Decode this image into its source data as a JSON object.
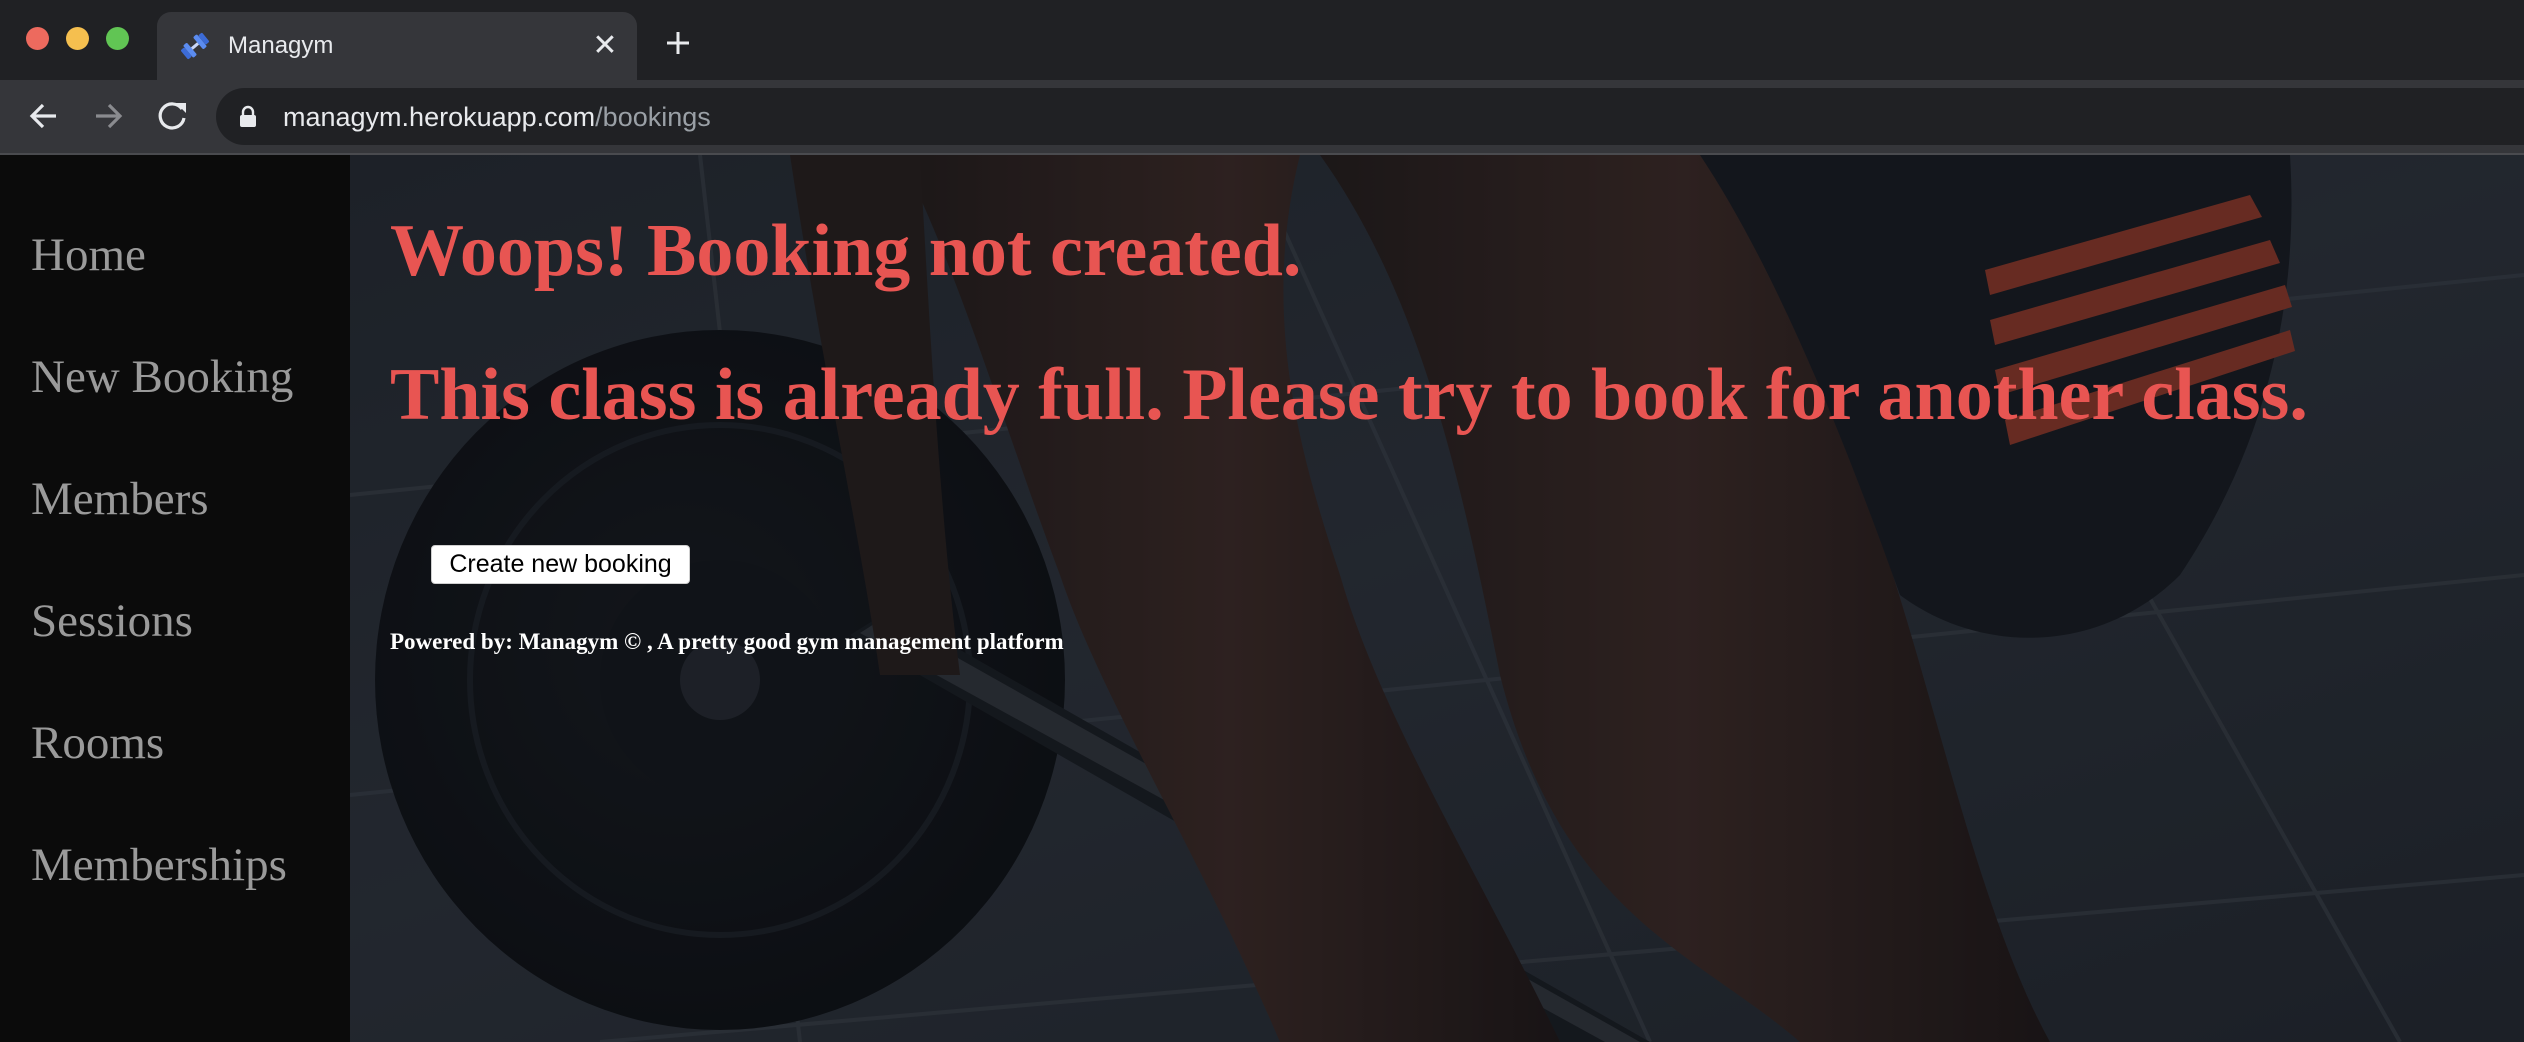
{
  "browser": {
    "tab": {
      "title": "Managym",
      "favicon": "dumbbell-icon",
      "close_label": "✕"
    },
    "new_tab_icon": "plus-icon",
    "omnibox": {
      "host": "managym.herokuapp.com",
      "path": "/bookings"
    }
  },
  "sidebar": {
    "items": [
      {
        "label": "Home"
      },
      {
        "label": "New Booking"
      },
      {
        "label": "Members"
      },
      {
        "label": "Sessions"
      },
      {
        "label": "Rooms"
      },
      {
        "label": "Memberships"
      }
    ]
  },
  "main": {
    "heading_error": "Woops! Booking not created.",
    "heading_message": "This class is already full. Please try to book for another class.",
    "create_button_label": "Create new booking",
    "footer": "Powered by: Managym © , A pretty good gym management platform"
  },
  "colors": {
    "error_red": "#e85552",
    "sidebar_bg": "#0b0b0b",
    "nav_text": "#9a9a9a"
  }
}
